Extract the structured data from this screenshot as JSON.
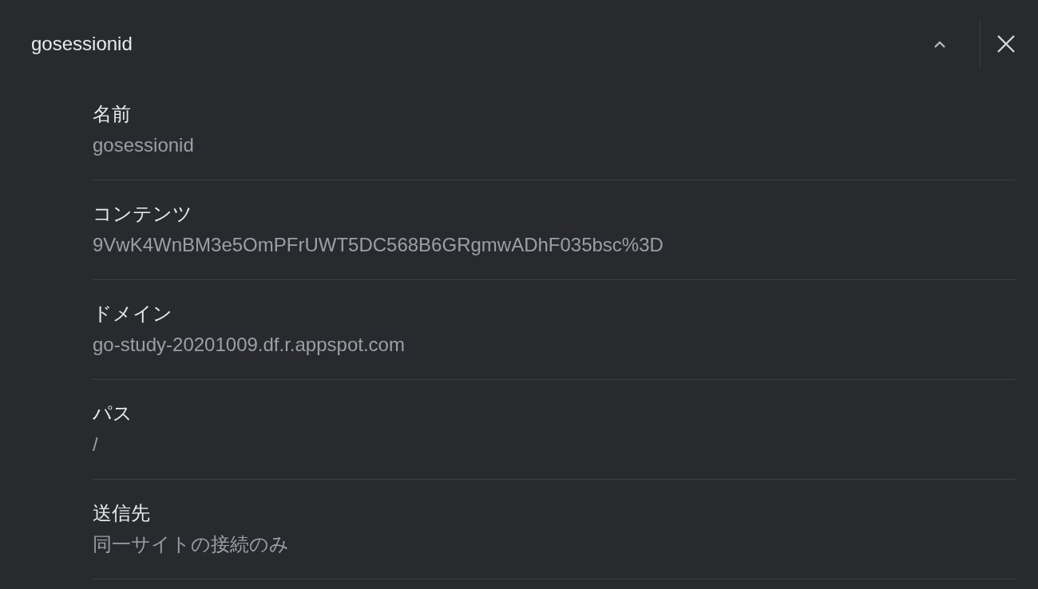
{
  "header": {
    "title": "gosessionid"
  },
  "fields": [
    {
      "label": "名前",
      "value": "gosessionid"
    },
    {
      "label": "コンテンツ",
      "value": "9VwK4WnBM3e5OmPFrUWT5DC568B6GRgmwADhF035bsc%3D"
    },
    {
      "label": "ドメイン",
      "value": "go-study-20201009.df.r.appspot.com"
    },
    {
      "label": "パス",
      "value": "/"
    },
    {
      "label": "送信先",
      "value": "同一サイトの接続のみ"
    }
  ]
}
